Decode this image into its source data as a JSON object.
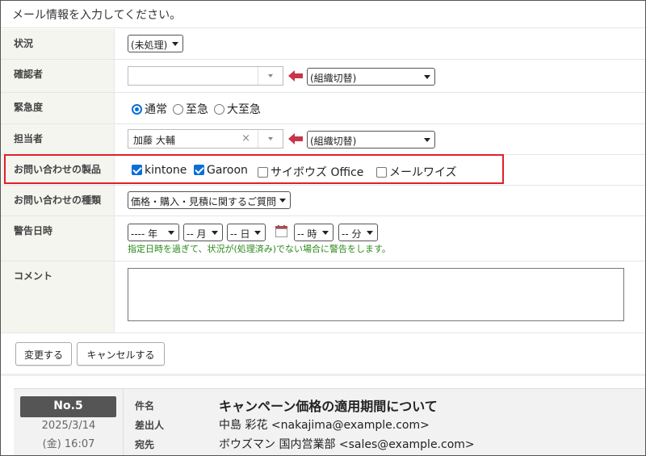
{
  "intro": "メール情報を入力してください。",
  "fields": {
    "status": {
      "label": "状況",
      "value": "(未処理)"
    },
    "confirmer": {
      "label": "確認者",
      "input_value": "",
      "org_select": "(組織切替)"
    },
    "urgency": {
      "label": "緊急度",
      "options": [
        "通常",
        "至急",
        "大至急"
      ],
      "selected": "通常"
    },
    "assignee": {
      "label": "担当者",
      "input_value": "加藤 大輔",
      "clear": "×",
      "org_select": "(組織切替)"
    },
    "products": {
      "label": "お問い合わせの製品",
      "options": [
        {
          "label": "kintone",
          "checked": true
        },
        {
          "label": "Garoon",
          "checked": true
        },
        {
          "label": "サイボウズ Office",
          "checked": false
        },
        {
          "label": "メールワイズ",
          "checked": false
        }
      ]
    },
    "inquiry_type": {
      "label": "お問い合わせの種類",
      "value": "価格・購入・見積に関するご質問"
    },
    "alert": {
      "label": "警告日時",
      "year": "---- 年",
      "month": "-- 月",
      "day": "-- 日",
      "hour": "-- 時",
      "minute": "-- 分",
      "note": "指定日時を過ぎて、状況が(処理済み)でない場合に警告をします。"
    },
    "comment": {
      "label": "コメント",
      "value": ""
    }
  },
  "buttons": {
    "save": "変更する",
    "cancel": "キャンセルする"
  },
  "mail": {
    "number": "No.5",
    "date": "2025/3/14",
    "time": "(金) 16:07",
    "subject_label": "件名",
    "subject": "キャンペーン価格の適用期間について",
    "from_label": "差出人",
    "from": "中島 彩花 <nakajima@example.com>",
    "to_label": "宛先",
    "to": "ボウズマン 国内営業部 <sales@example.com>"
  },
  "colors": {
    "highlight": "#e0202a",
    "accent": "#0b6ed6",
    "arrow": "#c8344a",
    "note": "#2a8a1a"
  }
}
